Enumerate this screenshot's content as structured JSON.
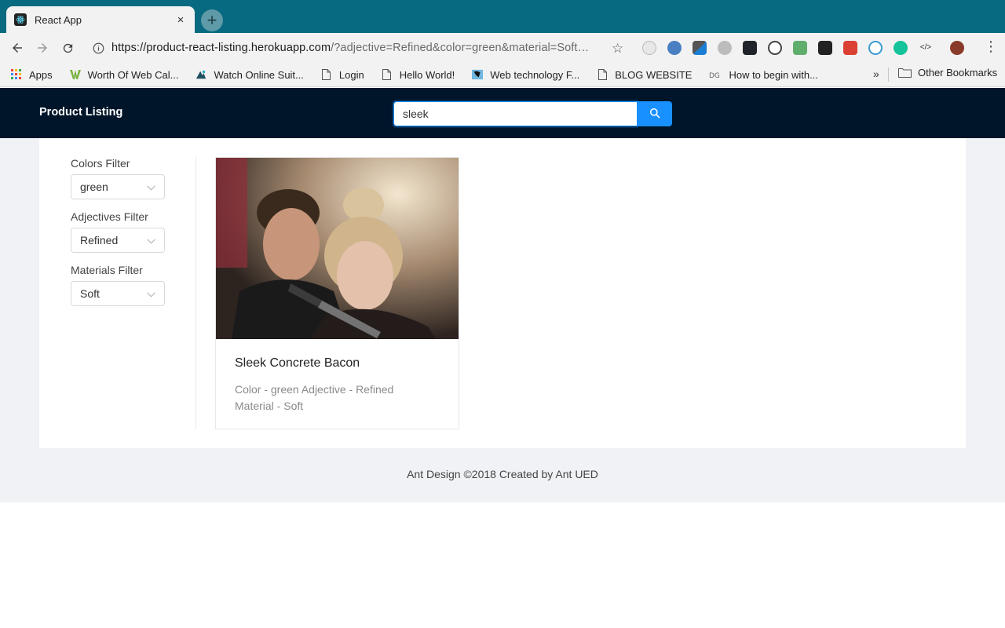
{
  "browser": {
    "tab": {
      "title": "React App",
      "close": "×"
    },
    "newtab": "+",
    "url": {
      "host": "https://product-react-listing.herokuapp.com",
      "path": "/?adjective=Refined&color=green&material=Soft…"
    },
    "bookmarks": [
      {
        "label": "Apps",
        "icon": "apps-grid-icon"
      },
      {
        "label": "Worth Of Web Cal...",
        "icon": "worth-of-web-icon"
      },
      {
        "label": "Watch Online Suit...",
        "icon": "watch-online-icon"
      },
      {
        "label": "Login",
        "icon": "page-icon"
      },
      {
        "label": "Hello World!",
        "icon": "page-icon"
      },
      {
        "label": "Web technology F...",
        "icon": "web-tech-icon"
      },
      {
        "label": "BLOG WEBSITE",
        "icon": "page-icon"
      },
      {
        "label": "How to begin with...",
        "icon": "dg-icon"
      }
    ],
    "bookmarks_more": "»",
    "other_bookmarks": "Other Bookmarks"
  },
  "app": {
    "logo": "Product Listing",
    "search": {
      "value": "sleek"
    },
    "filters": {
      "colors": {
        "label": "Colors Filter",
        "value": "green"
      },
      "adjectives": {
        "label": "Adjectives Filter",
        "value": "Refined"
      },
      "materials": {
        "label": "Materials Filter",
        "value": "Soft"
      }
    },
    "product": {
      "title": "Sleek Concrete Bacon",
      "line1": "Color - green Adjective - Refined",
      "line2": "Material - Soft"
    },
    "footer": "Ant Design ©2018 Created by Ant UED"
  },
  "colors": {
    "tabstrip": "#086a80",
    "header": "#001529",
    "primary": "#1890ff",
    "layout_bg": "#f0f2f5"
  }
}
